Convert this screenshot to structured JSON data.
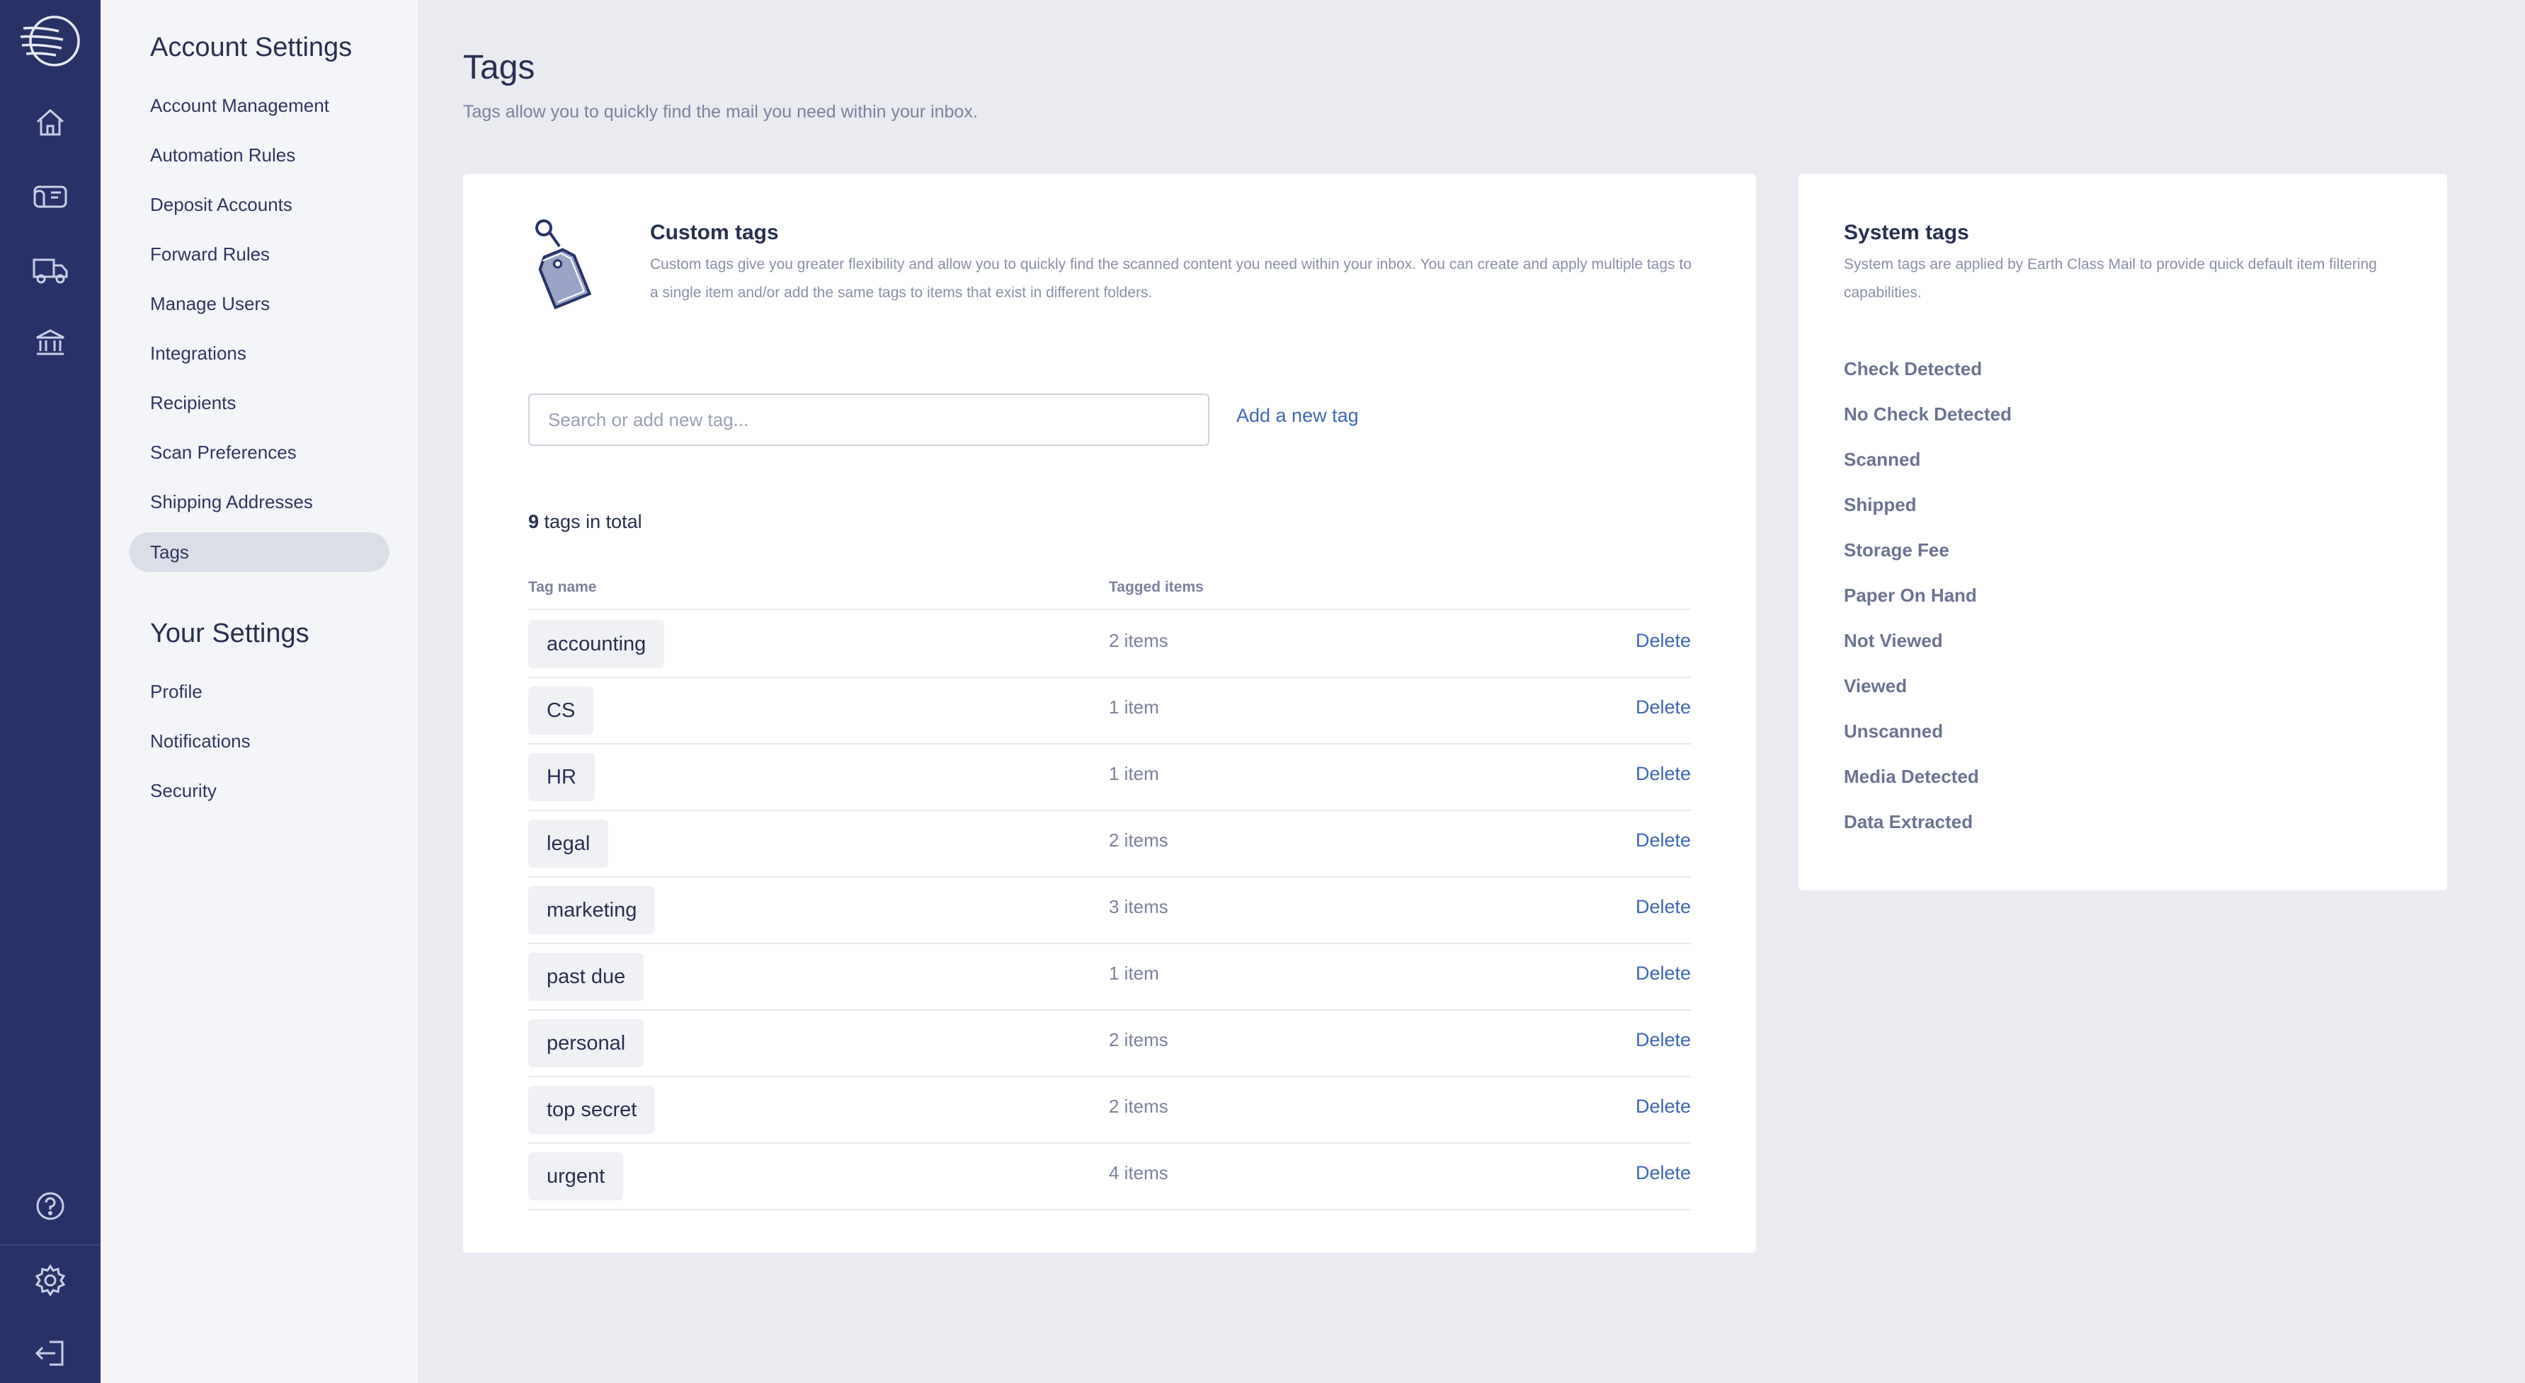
{
  "rail": {
    "icons": [
      "logo-icon",
      "home-icon",
      "mailbox-icon",
      "truck-icon",
      "bank-icon",
      "help-icon",
      "gear-icon",
      "logout-icon"
    ]
  },
  "nav": {
    "account_heading": "Account Settings",
    "account_items": [
      "Account Management",
      "Automation Rules",
      "Deposit Accounts",
      "Forward Rules",
      "Manage Users",
      "Integrations",
      "Recipients",
      "Scan Preferences",
      "Shipping Addresses",
      "Tags"
    ],
    "active_item": "Tags",
    "your_heading": "Your Settings",
    "your_items": [
      "Profile",
      "Notifications",
      "Security"
    ]
  },
  "page": {
    "title": "Tags",
    "subtitle": "Tags allow you to quickly find the mail you need within your inbox."
  },
  "custom": {
    "title": "Custom tags",
    "description": "Custom tags give you greater flexibility and allow you to quickly find the scanned content you need within your inbox. You can create and apply multiple tags to a single item and/or add the same tags to items that exist in different folders.",
    "search_placeholder": "Search or add new tag...",
    "search_value": "",
    "add_label": "Add a new tag",
    "total_count": "9",
    "total_suffix": " tags in total",
    "col_name": "Tag name",
    "col_items": "Tagged items",
    "delete_label": "Delete",
    "tags": [
      {
        "name": "accounting",
        "count": "2 items"
      },
      {
        "name": "CS",
        "count": "1 item"
      },
      {
        "name": "HR",
        "count": "1 item"
      },
      {
        "name": "legal",
        "count": "2 items"
      },
      {
        "name": "marketing",
        "count": "3 items"
      },
      {
        "name": "past due",
        "count": "1 item"
      },
      {
        "name": "personal",
        "count": "2 items"
      },
      {
        "name": "top secret",
        "count": "2 items"
      },
      {
        "name": "urgent",
        "count": "4 items"
      }
    ]
  },
  "system": {
    "title": "System tags",
    "description": "System tags are applied by Earth Class Mail to provide quick default item filtering capabilities.",
    "tags": [
      "Check Detected",
      "No Check Detected",
      "Scanned",
      "Shipped",
      "Storage Fee",
      "Paper On Hand",
      "Not Viewed",
      "Viewed",
      "Unscanned",
      "Media Detected",
      "Data Extracted"
    ]
  },
  "colors": {
    "rail": "#283266",
    "accent": "#3f67b5",
    "background": "#e9ebf1"
  }
}
